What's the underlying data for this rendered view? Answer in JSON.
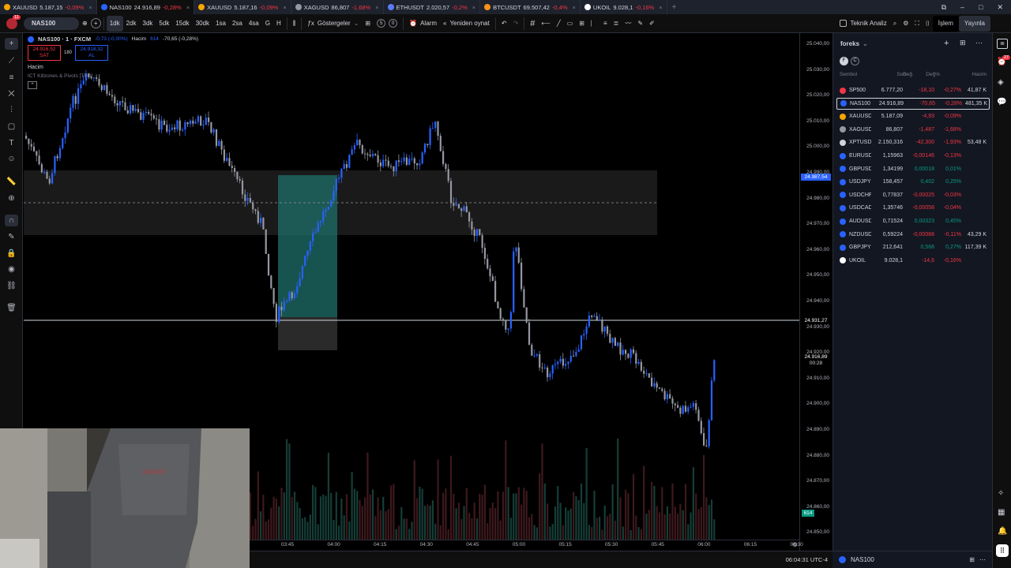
{
  "tabs": [
    {
      "symbol": "XAUUSD",
      "price": "5.187,15",
      "change": "-0,09%",
      "color": "#f7a600"
    },
    {
      "symbol": "NAS100",
      "price": "24.916,89",
      "change": "-0,28%",
      "color": "#2962ff"
    },
    {
      "symbol": "XAUUSD",
      "price": "5.187,16",
      "change": "-0,09%",
      "color": "#f7a600"
    },
    {
      "symbol": "XAGUSD",
      "price": "86,807",
      "change": "-1,68%",
      "color": "#9598a1"
    },
    {
      "symbol": "ETHUSDT",
      "price": "2.020,57",
      "change": "-0,2%",
      "color": "#5b7cfa"
    },
    {
      "symbol": "BTCUSDT",
      "price": "69.507,42",
      "change": "-0,4%",
      "color": "#f7931a"
    },
    {
      "symbol": "UKOIL",
      "price": "9.028,1",
      "change": "-0,16%",
      "color": "#ffffff"
    }
  ],
  "toolbar": {
    "symbol": "NAS100",
    "intervals": [
      "1dk",
      "2dk",
      "3dk",
      "5dk",
      "15dk",
      "30dk",
      "1sa",
      "2sa",
      "4sa",
      "G",
      "H"
    ],
    "active_interval": "1dk",
    "indicators": "Göstergeler",
    "alarm": "Alarm",
    "replay": "Yeniden oynat",
    "tech_analysis": "Teknik Analiz",
    "trade": "İşlem",
    "publish": "Yayınla",
    "notif_count": "11"
  },
  "legend": {
    "title": "NAS100 · 1 · FXCM",
    "change": "-0,73 (-0,00%)",
    "volume_label": "Hacim",
    "volume_value": "614",
    "volume_change": "-70,65 (-0,28%)",
    "sell_price": "24.916,52",
    "sell_label": "SAT",
    "spread": "180",
    "buy_price": "24.918,32",
    "buy_label": "AL",
    "indicator1": "Hacim",
    "indicator2": "ICT Killzones & Pivots [TFO]"
  },
  "price_axis": {
    "ticks": [
      "25.040,00",
      "25.030,00",
      "25.020,00",
      "25.010,00",
      "25.000,00",
      "24.990,00",
      "24.980,00",
      "24.970,00",
      "24.960,00",
      "24.950,00",
      "24.940,00",
      "24.930,00",
      "24.920,00",
      "24.910,00",
      "24.900,00",
      "24.890,00",
      "24.880,00",
      "24.870,00",
      "24.860,00",
      "24.850,00"
    ],
    "tag_dashed": "24.987,54",
    "tag_line": "24.931,27",
    "tag_last": "24.916,89",
    "tag_countdown": "00:28",
    "tag_volume": "614"
  },
  "time_axis": {
    "ticks": [
      "03:45",
      "04:00",
      "04:15",
      "04:30",
      "04:45",
      "05:00",
      "05:15",
      "05:30",
      "05:45",
      "06:00",
      "06:15",
      "06:30"
    ]
  },
  "bottom": {
    "clock": "06:04:31 UTC-4"
  },
  "watchlist": {
    "title": "foreks",
    "headers": [
      "Sembol",
      "Son",
      "Değ",
      "Değ%",
      "Hacim"
    ],
    "rows": [
      {
        "sym": "SP500",
        "last": "6.777,20",
        "chg": "-18,10",
        "pct": "-0,27%",
        "vol": "41,87 K",
        "dir": "down",
        "icon": "#f23645"
      },
      {
        "sym": "NAS100",
        "last": "24.916,89",
        "chg": "-70,65",
        "pct": "-0,28%",
        "vol": "481,35 K",
        "dir": "down",
        "icon": "#2962ff",
        "selected": true
      },
      {
        "sym": "XAUUSD",
        "last": "5.187,09",
        "chg": "-4,93",
        "pct": "-0,09%",
        "vol": "",
        "dir": "down",
        "icon": "#f7a600"
      },
      {
        "sym": "XAGUSD",
        "last": "86,807",
        "chg": "-1,487",
        "pct": "-1,68%",
        "vol": "",
        "dir": "down",
        "icon": "#9598a1"
      },
      {
        "sym": "XPTUSD",
        "last": "2.150,316",
        "chg": "-42,300",
        "pct": "-1,93%",
        "vol": "53,48 K",
        "dir": "down",
        "icon": "#d1d4dc"
      },
      {
        "sym": "EURUSD",
        "last": "1,15963",
        "chg": "-0,00146",
        "pct": "-0,13%",
        "vol": "",
        "dir": "down",
        "icon": "#2962ff"
      },
      {
        "sym": "GBPUSD",
        "last": "1,34199",
        "chg": "0,00018",
        "pct": "0,01%",
        "vol": "",
        "dir": "up",
        "icon": "#2962ff"
      },
      {
        "sym": "USDJPY",
        "last": "158,457",
        "chg": "0,402",
        "pct": "0,25%",
        "vol": "",
        "dir": "up",
        "icon": "#2962ff"
      },
      {
        "sym": "USDCHF",
        "last": "0,77837",
        "chg": "-0,00025",
        "pct": "-0,03%",
        "vol": "",
        "dir": "down",
        "icon": "#2962ff"
      },
      {
        "sym": "USDCAD",
        "last": "1,35746",
        "chg": "-0,00058",
        "pct": "-0,04%",
        "vol": "",
        "dir": "down",
        "icon": "#2962ff"
      },
      {
        "sym": "AUDUSD",
        "last": "0,71524",
        "chg": "0,00323",
        "pct": "0,45%",
        "vol": "",
        "dir": "up",
        "icon": "#2962ff"
      },
      {
        "sym": "NZDUSD",
        "last": "0,59224",
        "chg": "-0,00068",
        "pct": "-0,11%",
        "vol": "43,29 K",
        "dir": "down",
        "icon": "#2962ff"
      },
      {
        "sym": "GBPJPY",
        "last": "212,641",
        "chg": "0,568",
        "pct": "0,27%",
        "vol": "117,39 K",
        "dir": "up",
        "icon": "#2962ff"
      },
      {
        "sym": "UKOIL",
        "last": "9.028,1",
        "chg": "-14,6",
        "pct": "-0,16%",
        "vol": "",
        "dir": "down",
        "icon": "#ffffff"
      }
    ],
    "bottom_symbol": "NAS100",
    "badge": "27"
  },
  "colors": {
    "up": "#089981",
    "down": "#f23645",
    "bull_candle": "#2962ff",
    "bear_candle": "#9598a1",
    "selection": "#2962ff"
  },
  "webcam": {
    "brand": "XDRIVE"
  }
}
